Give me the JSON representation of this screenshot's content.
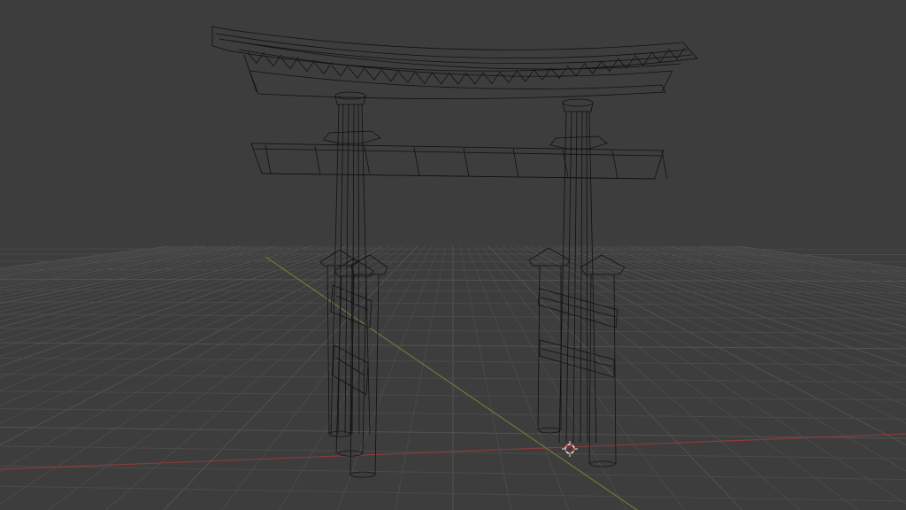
{
  "viewport": {
    "mode": "wireframe",
    "colors": {
      "background": "#3d3d3d",
      "grid": "#4a4a4a",
      "grid_major": "#525252",
      "wire": "#111111",
      "x_axis": "#8a3b3b",
      "y_axis": "#6b7a3a",
      "cursor_red": "#d24a3a",
      "cursor_white": "#e8e8e8"
    }
  },
  "scene": {
    "object": "torii-gate",
    "cursor": "3d-cursor-icon"
  }
}
